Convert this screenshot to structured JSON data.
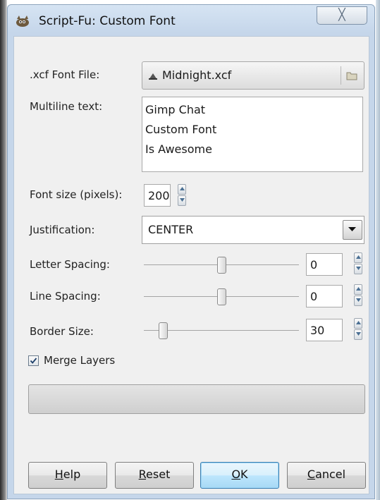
{
  "window": {
    "title": "Script-Fu: Custom Font",
    "close_glyph": "╳"
  },
  "form": {
    "font_file": {
      "label": ".xcf Font File:",
      "value": "Midnight.xcf"
    },
    "multiline": {
      "label": "Multiline text:",
      "lines": [
        "Gimp Chat",
        "Custom Font",
        "Is Awesome"
      ]
    },
    "font_size": {
      "label": "Font size (pixels):",
      "value": "200"
    },
    "justification": {
      "label": "Justification:",
      "value": "CENTER"
    },
    "letter_spacing": {
      "label": "Letter Spacing:",
      "value": "0",
      "slider_fraction": 0.5
    },
    "line_spacing": {
      "label": "Line Spacing:",
      "value": "0",
      "slider_fraction": 0.5
    },
    "border_size": {
      "label": "Border Size:",
      "value": "30",
      "slider_fraction": 0.1
    },
    "merge_layers": {
      "label": "Merge Layers",
      "checked": true
    }
  },
  "buttons": {
    "help": {
      "mnemonic": "H",
      "rest": "elp"
    },
    "reset": {
      "mnemonic": "R",
      "rest": "eset"
    },
    "ok": {
      "mnemonic": "O",
      "rest": "K"
    },
    "cancel": {
      "mnemonic": "C",
      "rest": "ancel"
    }
  },
  "colors": {
    "accent": "#3c7fb1",
    "title_bar": "#c5d6ea"
  },
  "icons": [
    "gimp-wilber-icon",
    "close-icon",
    "xcf-file-icon",
    "folder-icon",
    "spin-up-icon",
    "spin-down-icon",
    "dropdown-arrow-icon",
    "checkmark-icon"
  ]
}
